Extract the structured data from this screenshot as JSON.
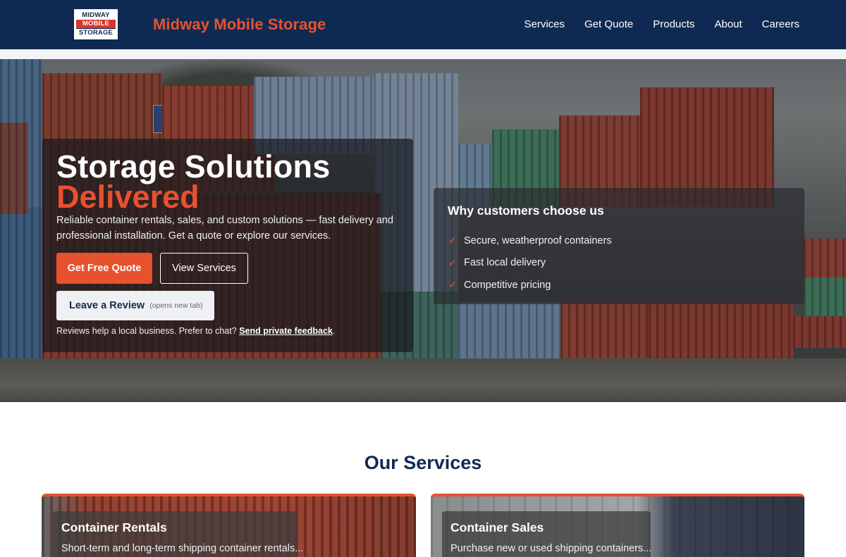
{
  "header": {
    "logo": {
      "line1": "MIDWAY",
      "line2": "MOBILE",
      "line3": "STORAGE"
    },
    "brand": "Midway Mobile Storage",
    "nav": [
      "Services",
      "Get Quote",
      "Products",
      "About",
      "Careers"
    ]
  },
  "hero": {
    "title": "Storage Solutions",
    "title_accent": "Delivered",
    "subtitle": "Reliable container rentals, sales, and custom solutions — fast delivery and professional installation. Get a quote or explore our services.",
    "primary_button": "Get Free Quote",
    "secondary_button": "View Services",
    "review_button": "Leave a Review",
    "review_button_hint": "(opens new tab)",
    "review_note": "Reviews help a local business. Prefer to chat?",
    "review_link": "Send private feedback",
    "review_note_end": "."
  },
  "why": {
    "title": "Why customers choose us",
    "items": [
      "Secure, weatherproof containers",
      "Fast local delivery",
      "Competitive pricing"
    ],
    "check_icon": "check-icon"
  },
  "services": {
    "title": "Our Services",
    "cards": [
      {
        "name": "Container Rentals",
        "desc": "Short-term and long-term shipping container rentals..."
      },
      {
        "name": "Container Sales",
        "desc": "Purchase new or used shipping containers..."
      }
    ]
  },
  "colors": {
    "header_bg": "#0f2a52",
    "accent": "#e8512e",
    "heading": "#0f2a52"
  }
}
